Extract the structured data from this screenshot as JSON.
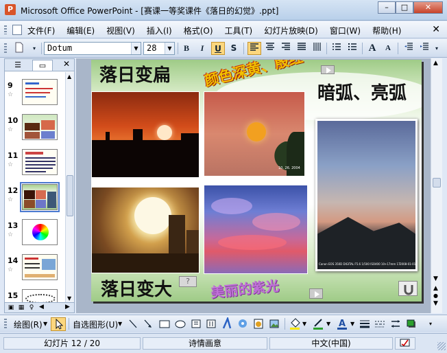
{
  "window": {
    "title": "Microsoft Office PowerPoint - [赛课一等奖课件《落日的幻觉》.ppt]",
    "minimize": "–",
    "maximize": "□",
    "close": "✕"
  },
  "menu": {
    "items": [
      "文件(F)",
      "编辑(E)",
      "视图(V)",
      "插入(I)",
      "格式(O)",
      "工具(T)",
      "幻灯片放映(D)",
      "窗口(W)",
      "帮助(H)"
    ],
    "close": "✕"
  },
  "toolbar": {
    "font_name": "Dotum",
    "font_size": "28",
    "bold": "B",
    "italic": "I",
    "underline": "U",
    "shadow": "S",
    "increase_font": "A",
    "decrease_font": "A"
  },
  "slide_pane": {
    "close": "✕",
    "slides": [
      {
        "number": "9"
      },
      {
        "number": "10"
      },
      {
        "number": "11"
      },
      {
        "number": "12"
      },
      {
        "number": "13"
      },
      {
        "number": "14"
      },
      {
        "number": "15"
      }
    ],
    "selected": "12"
  },
  "slide": {
    "title_left": "落日变扁",
    "title_arc": "颜色深黄、殷红",
    "title_right": "暗弧、亮弧",
    "bottom_left": "落日变大",
    "bottom_middle": "美丽的紫光",
    "question_mark": "?",
    "photo2_stamp": "10. 26. 2004",
    "photo5_caption": "Canon EOS 350D DIGITAL F5.6 1/500 ISO400 10+17mm 17",
    "photo5_date": "2008-01-01"
  },
  "drawbar": {
    "draw": "绘图(R)",
    "autoshapes": "自选图形(U)"
  },
  "status": {
    "slide_info": "幻灯片 12 / 20",
    "design": "诗情画意",
    "language": "中文(中国)"
  }
}
